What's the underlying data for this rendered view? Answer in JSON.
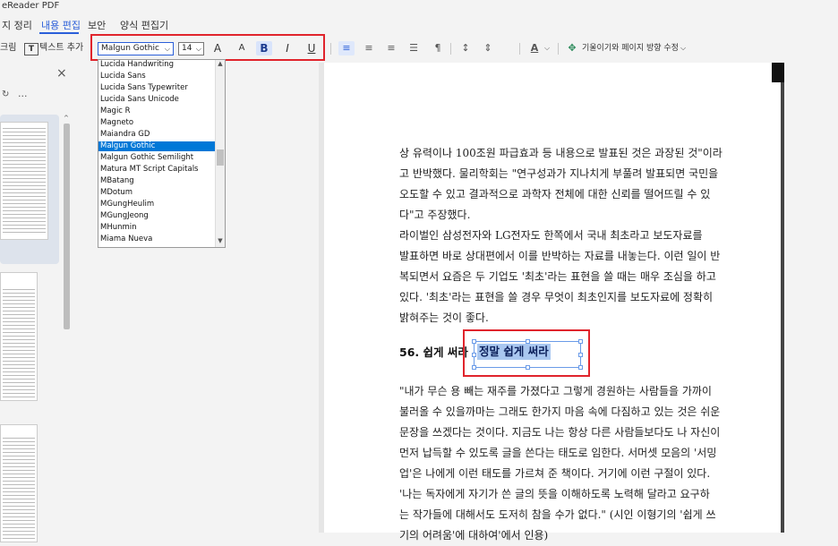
{
  "window": {
    "title": "eReader PDF"
  },
  "menu": {
    "tabs": [
      "지 정리",
      "내용 편집",
      "보안",
      "양식 편집기"
    ],
    "active_index": 1
  },
  "toolbar": {
    "left_items": [
      "크림",
      "텍스트 추가"
    ],
    "font_family": "Malgun Gothic",
    "font_size": "14",
    "grow_font": "A",
    "shrink_font": "A",
    "bold": "B",
    "italic": "I",
    "underline": "U",
    "font_color": "A",
    "tilt_label": "기울이기와 페이지 방향 수정"
  },
  "font_dropdown": {
    "options": [
      "Lucida Handwriting",
      "Lucida Sans",
      "Lucida Sans Typewriter",
      "Lucida Sans Unicode",
      "Magic R",
      "Magneto",
      "Maiandra GD",
      "Malgun Gothic",
      "Malgun Gothic Semilight",
      "Matura MT Script Capitals",
      "MBatang",
      "MDotum",
      "MGungHeulim",
      "MGungJeong",
      "MHunmin",
      "Miama Nueva"
    ],
    "selected": "Malgun Gothic"
  },
  "side": {
    "close": "×",
    "more": "..."
  },
  "document": {
    "para1": [
      "상 유력이나 100조원 파급효과 등 내용으로 발표된 것은 과장된 것\"이라",
      "고 반박했다. 물리학회는 \"연구성과가 지나치게 부풀려 발표되면 국민을",
      "오도할 수 있고 결과적으로 과학자 전체에 대한 신뢰를 떨어뜨릴 수 있",
      "다\"고 주장했다.",
      "  라이벌인 삼성전자와 LG전자도 한쪽에서 국내 최초라고 보도자료를",
      "발표하면 바로 상대편에서 이를 반박하는 자료를 내놓는다. 이런 일이 반",
      "복되면서 요즘은 두 기업도 '최초'라는 표현을 쓸 때는 매우 조심을 하고",
      "있다. '최초'라는 표현을 쓸 경우 무엇이 최초인지를 보도자료에 정확히",
      "밝혀주는 것이 좋다."
    ],
    "heading": "56. 쉽게 써라",
    "edit_text": "정말 쉽게 써라",
    "para2": [
      "  \"내가 무슨 용 빼는 재주를 가졌다고 그렇게 경원하는 사람들을 가까이",
      "불러올 수 있을까마는 그래도 한가지 마음 속에 다짐하고 있는 것은 쉬운",
      "문장을 쓰겠다는 것이다. 지금도 나는 항상 다른 사람들보다도 나 자신이",
      "먼저 납득할 수 있도록 글을 쓴다는 태도로 임한다. 서머셋 모음의 '서밍",
      "업'은 나에게 이런 태도를 가르쳐 준 책이다. 거기에 이런 구절이 있다.",
      "'나는 독자에게 자기가 쓴 글의 뜻을 이해하도록 노력해 달라고 요구하",
      "는 작가들에 대해서도 도저히 참을 수가 없다.\" (시인 이형기의 '쉽게 쓰",
      "기의 어려움'에 대하여'에서 인용)"
    ]
  }
}
